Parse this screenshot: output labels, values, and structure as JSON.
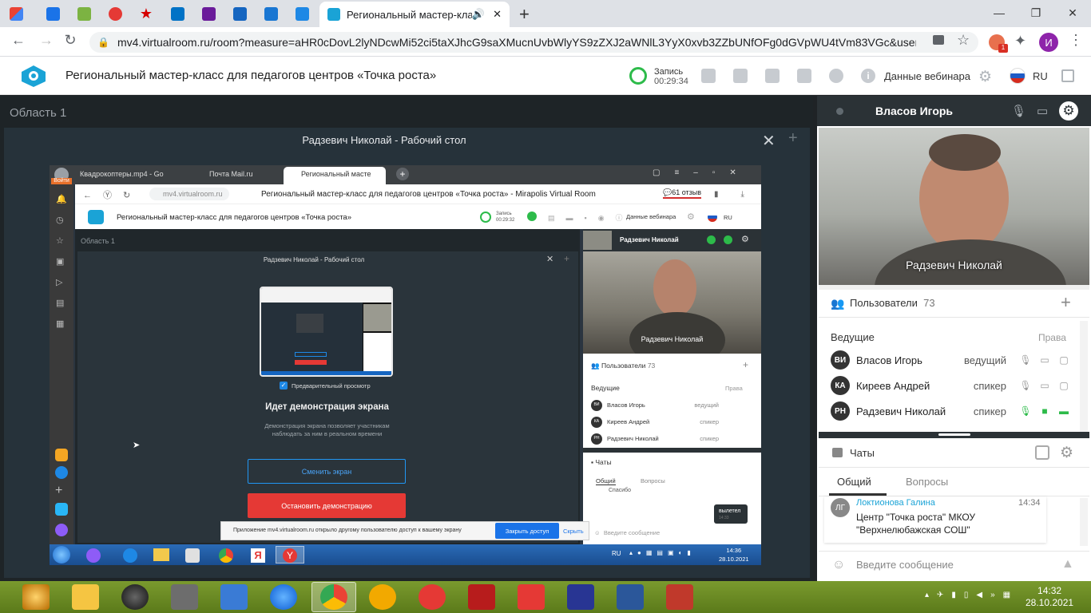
{
  "browser": {
    "active_tab_title": "Региональный мастер-клас",
    "url": "mv4.virtualroom.ru/room?measure=aHR0cDovL2lyNDcwMi52ci5taXJhcG9saXMucnUvbWlyYS9zZXJ2aWNlL3YyX0xvb3ZZbUNfOFg0dGVpWU4tVm83VGc&user=FA...",
    "profile_initial": "И",
    "ext_badge": "1"
  },
  "app": {
    "title": "Региональный мастер-класс для педагогов центров «Точка роста»",
    "record_label": "Запись",
    "record_time": "00:29:34",
    "webinar_data": "Данные вебинара",
    "lang": "RU"
  },
  "area": {
    "title": "Область 1",
    "share_title": "Радзевич Николай - Рабочий стол"
  },
  "inner": {
    "tab1": "Квадрокоптеры.mp4 - Go",
    "tab2": "Почта Mail.ru",
    "tab3": "Региональный масте",
    "url_host": "mv4.virtualroom.ru",
    "page_title": "Региональный мастер-класс для педагогов центров «Точка роста» - Mirapolis Virtual Room",
    "reviews": "61 отзыв",
    "app_title": "Региональный мастер-класс для педагогов центров «Точка роста»",
    "record_label": "Запись",
    "record_time": "00:29:32",
    "webinar_data": "Данные вебинара",
    "lang": "RU",
    "area_title": "Область 1",
    "share_title": "Радзевич Николай - Рабочий стол",
    "preview_label": "Предварительный просмотр",
    "demo_heading": "Идет демонстрация экрана",
    "demo_text": "Демонстрация экрана позволяет участникам наблюдать за ним в реальном времени",
    "change_screen": "Сменить экран",
    "stop_demo": "Остановить демонстрацию",
    "user_head": "Радзевич Николай",
    "video_name": "Радзевич Николай",
    "users_label": "Пользователи",
    "users_count": "73",
    "hosts": "Ведущие",
    "rights": "Права",
    "users": [
      {
        "initials": "ВИ",
        "name": "Власов Игорь",
        "role": "ведущий"
      },
      {
        "initials": "КА",
        "name": "Киреев Андрей",
        "role": "спикер"
      },
      {
        "initials": "РН",
        "name": "Радзевич Николай",
        "role": "спикер"
      }
    ],
    "chats": "Чаты",
    "chat_general": "Общий",
    "chat_questions": "Вопросы",
    "chat_prev": "Спасибо",
    "chat_bubble": "вылетел",
    "chat_bubble_time": "14:33",
    "chat_input": "Введите сообщение",
    "notif_text": "Приложение mv4.virtualroom.ru открыло другому пользователю доступ к вашему экрану",
    "notif_close": "Закрыть доступ",
    "notif_hide": "Скрыть",
    "login": "Войти",
    "tray_lang": "RU",
    "time": "14:36",
    "date": "28.10.2021"
  },
  "right": {
    "presenter": "Власов Игорь",
    "video_name": "Радзевич Николай",
    "users_label": "Пользователи",
    "users_count": "73",
    "hosts": "Ведущие",
    "rights": "Права",
    "users": [
      {
        "initials": "ВИ",
        "name": "Власов Игорь",
        "role": "ведущий"
      },
      {
        "initials": "КА",
        "name": "Киреев Андрей",
        "role": "спикер"
      },
      {
        "initials": "РН",
        "name": "Радзевич Николай",
        "role": "спикер"
      }
    ],
    "chats": "Чаты",
    "chat_general": "Общий",
    "chat_questions": "Вопросы",
    "msg_initials": "ЛГ",
    "msg_author": "Локтионова Галина",
    "msg_time": "14:34",
    "msg_text": "Центр \"Точка роста\" МКОУ \"Верхнелюбажская СОШ\"",
    "chat_input": "Введите сообщение"
  },
  "taskbar": {
    "time": "14:32",
    "date": "28.10.2021"
  },
  "colors": {
    "brand": "#1aa3d6",
    "green": "#2dbb4a",
    "red_button": "#e53935",
    "link_blue": "#1a73e8"
  }
}
